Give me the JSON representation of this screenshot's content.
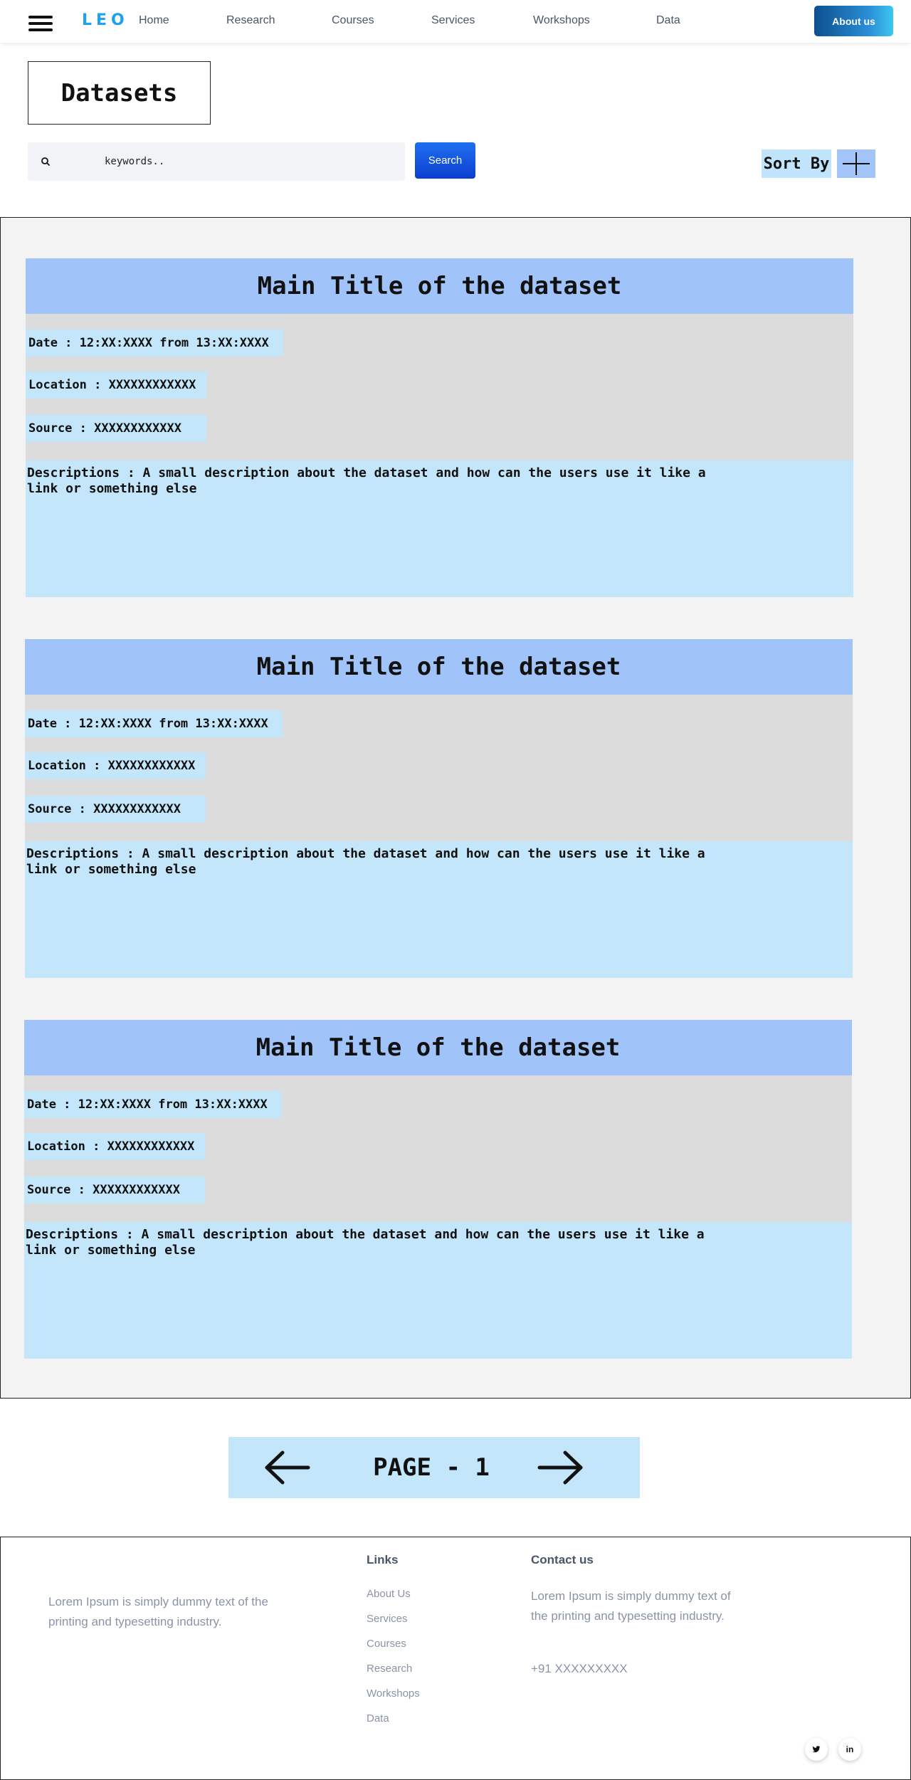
{
  "nav": {
    "logo": "LEO",
    "links": [
      "Home",
      "Research",
      "Courses",
      "Services",
      "Workshops",
      "Data"
    ],
    "about_label": "About us"
  },
  "page": {
    "title": "Datasets"
  },
  "search": {
    "placeholder": "keywords..",
    "button_label": "Search"
  },
  "sort": {
    "label": "Sort By"
  },
  "datasets": [
    {
      "title": "Main Title of the dataset",
      "date": "Date : 12:XX:XXXX from 13:XX:XXXX",
      "location": "Location : XXXXXXXXXXXX",
      "source": "Source : XXXXXXXXXXXX",
      "description": "Descriptions : A small description about the dataset and how can the users use it like a link or something else"
    },
    {
      "title": "Main Title of the dataset",
      "date": "Date : 12:XX:XXXX from 13:XX:XXXX",
      "location": "Location : XXXXXXXXXXXX",
      "source": "Source : XXXXXXXXXXXX",
      "description": "Descriptions : A small description about the dataset and how can the users use it like a link or something else"
    },
    {
      "title": "Main Title of the dataset",
      "date": "Date : 12:XX:XXXX from 13:XX:XXXX",
      "location": "Location : XXXXXXXXXXXX",
      "source": "Source : XXXXXXXXXXXX",
      "description": "Descriptions : A small description about the dataset and how can the users use it like a link or something else"
    }
  ],
  "pagination": {
    "label": "PAGE - 1"
  },
  "footer": {
    "about_text": "Lorem Ipsum is simply dummy text of the printing and typesetting industry.",
    "links_title": "Links",
    "links": [
      "About Us",
      "Services",
      "Courses",
      "Research",
      "Workshops",
      "Data"
    ],
    "contact_title": "Contact us",
    "contact_text": "Lorem Ipsum is simply dummy text of the printing and typesetting industry.",
    "phone": "+91 XXXXXXXXX",
    "social": [
      {
        "icon": "twitter-icon",
        "glyph": "🐦"
      },
      {
        "icon": "linkedin-icon",
        "glyph": "in"
      }
    ]
  }
}
